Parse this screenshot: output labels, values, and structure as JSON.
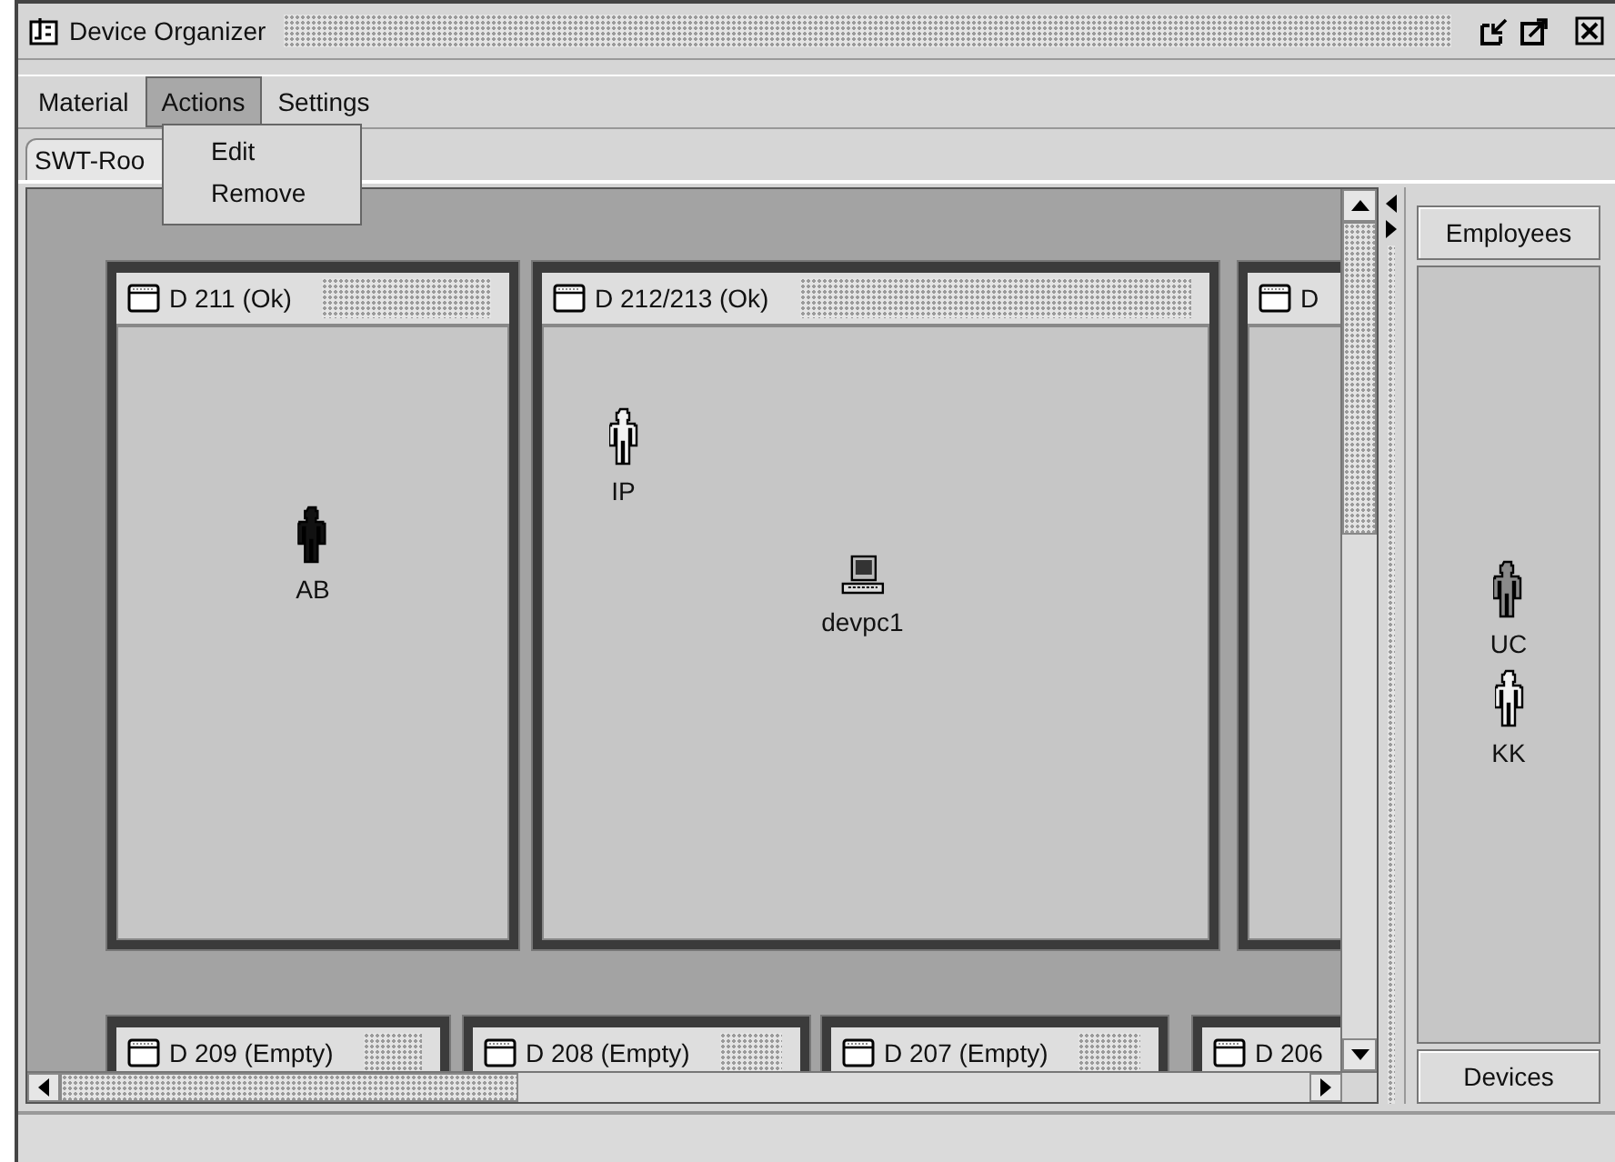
{
  "window": {
    "title": "Device Organizer"
  },
  "menu": [
    {
      "label": "Material",
      "selected": false
    },
    {
      "label": "Actions",
      "selected": true
    },
    {
      "label": "Settings",
      "selected": false
    }
  ],
  "open_menu": {
    "items": [
      "Edit",
      "Remove"
    ]
  },
  "tabs": [
    {
      "label": "SWT-Roo",
      "selected": true
    }
  ],
  "rooms": [
    {
      "title": "D 211 (Ok)",
      "items": [
        {
          "kind": "person",
          "label": "AB",
          "color": "#111111"
        }
      ]
    },
    {
      "title": "D 212/213 (Ok)",
      "items": [
        {
          "kind": "person",
          "label": "IP",
          "color": "#f2f2f2"
        },
        {
          "kind": "computer",
          "label": "devpc1"
        }
      ]
    },
    {
      "title": "D"
    },
    {
      "title": "D 209 (Empty)"
    },
    {
      "title": "D 208 (Empty)"
    },
    {
      "title": "D 207 (Empty)"
    },
    {
      "title": "D 206"
    }
  ],
  "side_panel": {
    "top_button": "Employees",
    "employees": [
      {
        "label": "UC",
        "color": "#8a8a8a"
      },
      {
        "label": "KK",
        "color": "#f2f2f2"
      }
    ],
    "bottom_button": "Devices"
  }
}
